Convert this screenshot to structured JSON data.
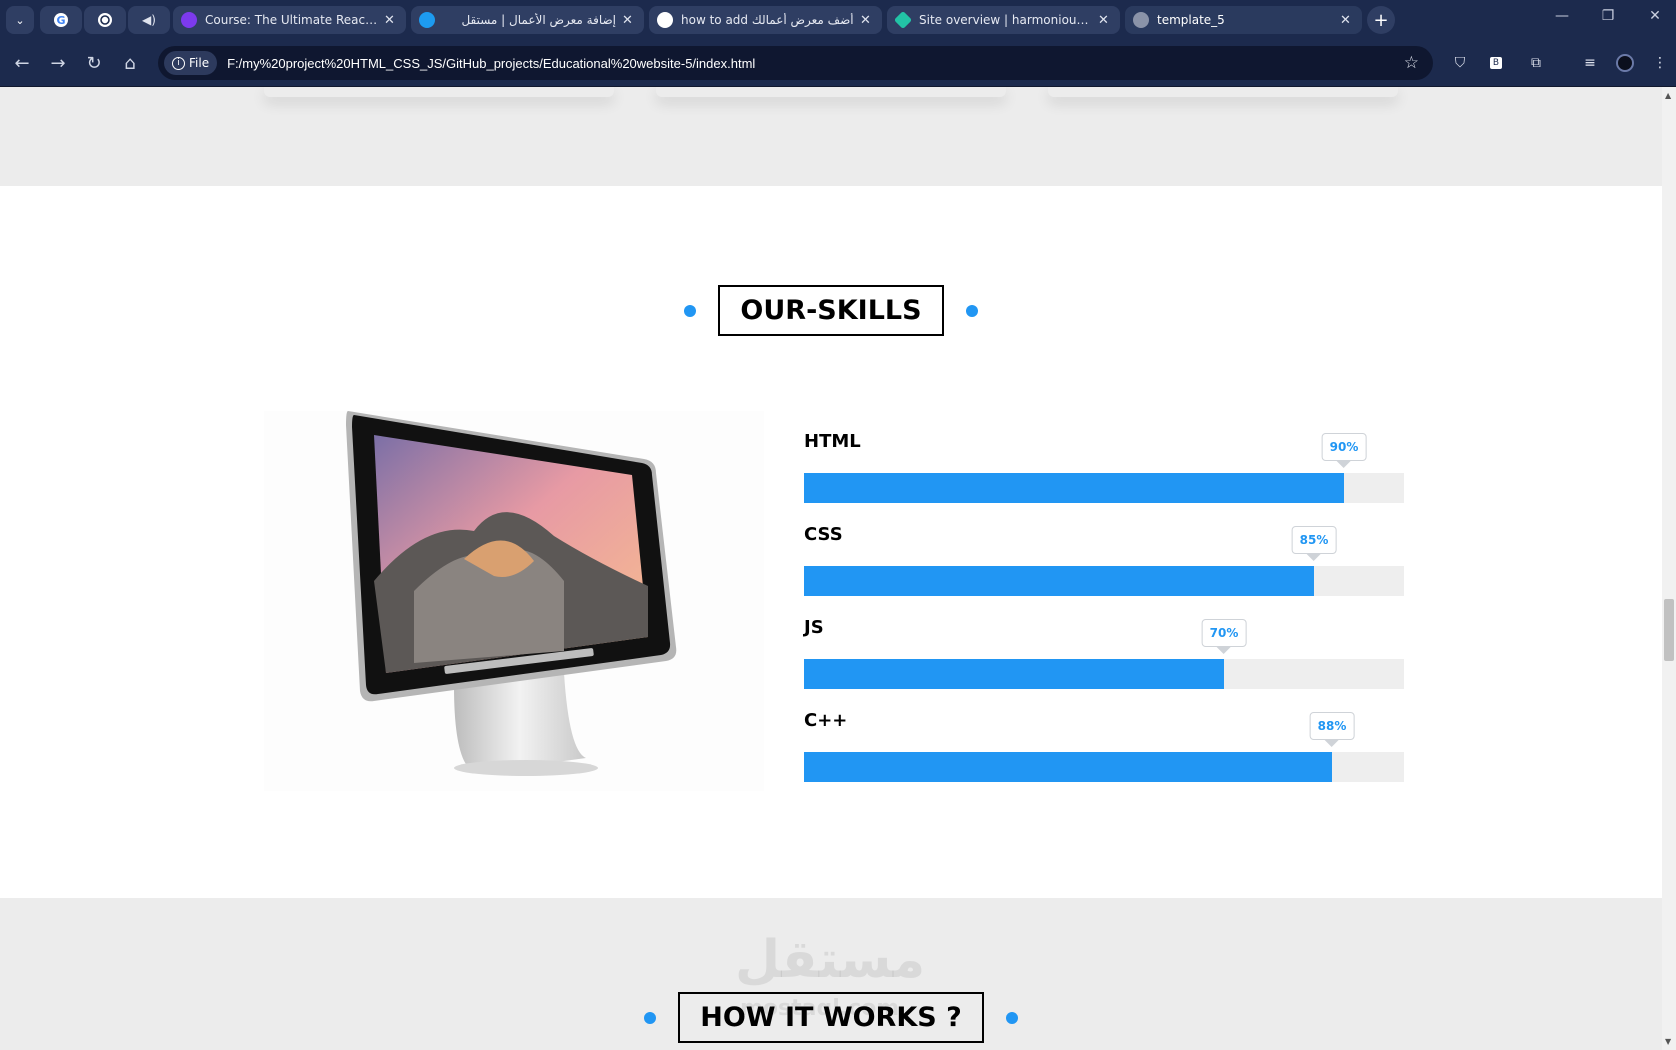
{
  "browser": {
    "tabs": [
      {
        "title": "Course: The Ultimate React Cou",
        "color": "#7c3aed"
      },
      {
        "title": "إضافة معرض الأعمال | مستقل",
        "color": "#1d9bf0"
      },
      {
        "title": "how to add أضف معرض أعمالك",
        "color": "#ffffff"
      },
      {
        "title": "Site overview | harmonious-gec",
        "color": "#22c3a6"
      },
      {
        "title": "template_5",
        "color": "#8a93a8"
      }
    ],
    "address_chip": "File",
    "url": "F:/my%20project%20HTML_CSS_JS/GitHub_projects/Educational%20website-5/index.html"
  },
  "skills": {
    "heading": "OUR-SKILLS",
    "items": [
      {
        "name": "HTML",
        "percent_label": "90%",
        "percent": 90
      },
      {
        "name": "CSS",
        "percent_label": "85%",
        "percent": 85
      },
      {
        "name": "JS",
        "percent_label": "70%",
        "percent": 70
      },
      {
        "name": "C++",
        "percent_label": "88%",
        "percent": 88
      }
    ]
  },
  "how_it_works": {
    "heading": "HOW IT WORKS ?",
    "watermark": "مستقل",
    "watermark_sub": "mostaql.com"
  },
  "colors": {
    "accent": "#2196f3",
    "chrome": "#1c2a4d"
  }
}
